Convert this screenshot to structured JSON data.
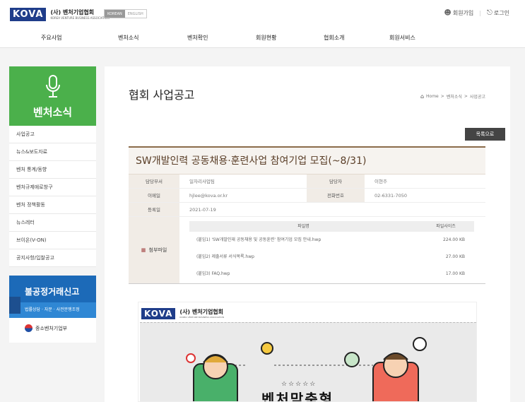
{
  "header": {
    "logo_mark": "KOVA",
    "logo_name": "(사) 벤처기업협회",
    "logo_subname": "KOREA VENTURE BUSINESS ASSOCIATION",
    "lang_korean": "KOREAN",
    "lang_english": "ENGLISH",
    "join_label": "회원가입",
    "login_label": "로그인"
  },
  "gnb": [
    "주요사업",
    "벤처소식",
    "벤처확인",
    "회원현황",
    "협회소개",
    "회원서비스"
  ],
  "sidebar": {
    "title": "벤처소식",
    "items": [
      "사업공고",
      "뉴스&보도자료",
      "벤처 통계/동향",
      "벤처규제애로창구",
      "벤처 정책활동",
      "뉴스레터",
      "브이온(V-ON)",
      "공지사항/입찰공고"
    ]
  },
  "banner": {
    "headline": "불공정거래신고",
    "subline": "법률상담 · 자문 · 사전분쟁조정",
    "ministry": "중소벤처기업부"
  },
  "page": {
    "title": "협회 사업공고",
    "breadcrumb": [
      "Home",
      "벤처소식",
      "사업공고"
    ],
    "list_button": "목록으로"
  },
  "article": {
    "title": "SW개발인력 공동채용·훈련사업 참여기업 모집(~8/31)",
    "dept_label": "담당부서",
    "dept": "일자리사업팀",
    "manager_label": "담당자",
    "manager": "이현주",
    "email_label": "이메일",
    "email": "hjlee@kova.or.kr",
    "phone_label": "전화번호",
    "phone": "02-6331-7050",
    "date_label": "등록일",
    "date": "2021-07-19",
    "attach_label": "첨부파일",
    "file_col_name": "파일명",
    "file_col_size": "파일사이즈",
    "files": [
      {
        "name": "(붙임1) 'SW개발인재 공동채용 및 공동훈련' 참여기업 모집 안내.hwp",
        "size": "224.00 KB"
      },
      {
        "name": "(붙임2) 제출서류 서식목록.hwp",
        "size": "27.00 KB"
      },
      {
        "name": "(붙임3) FAQ.hwp",
        "size": "17.00 KB"
      }
    ]
  },
  "poster": {
    "logo_mark": "KOVA",
    "logo_name": "(사) 벤처기업협회",
    "logo_subname": "KOREA VENTURE BUSINESS ASSOCIATION",
    "stars": "☆☆☆☆☆",
    "headline": "벤처맞춤형"
  },
  "colors": {
    "brand_blue": "#1f3d8a",
    "side_green": "#4bb04b",
    "article_brown": "#8b6b4a"
  }
}
